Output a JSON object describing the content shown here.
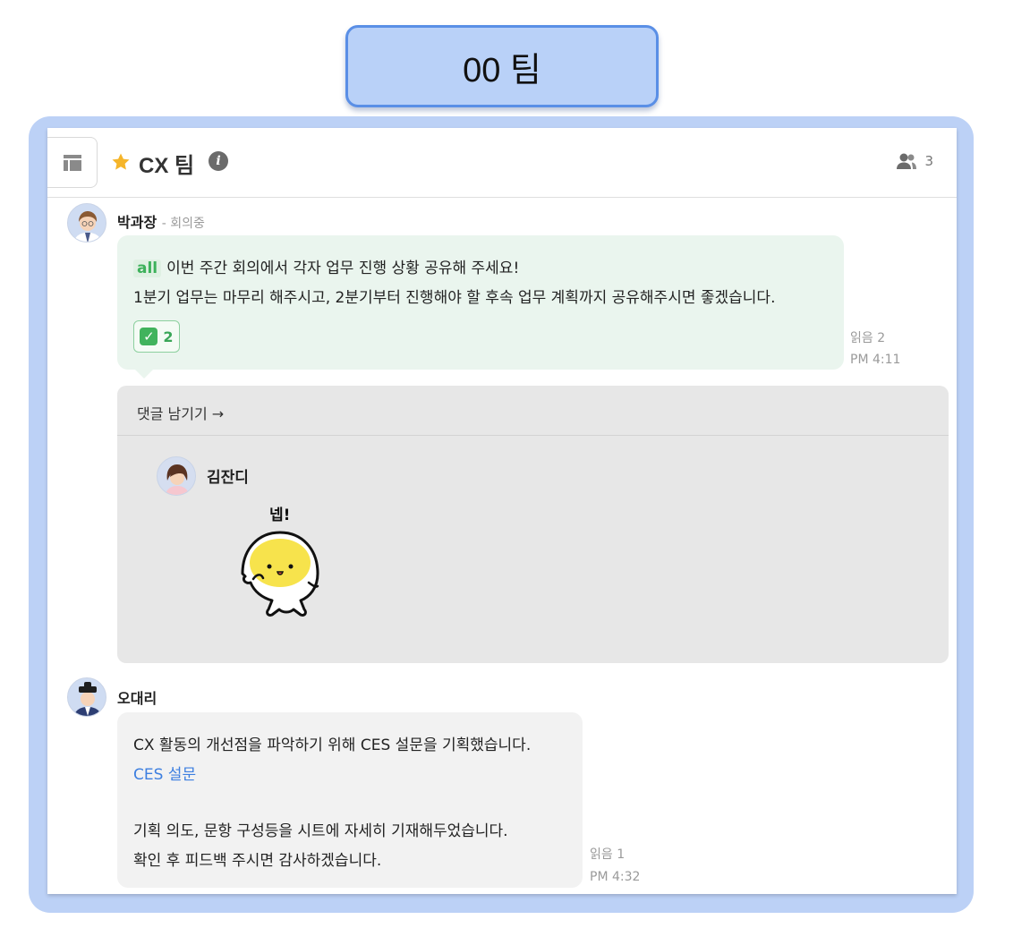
{
  "team_label": "00 팀",
  "header": {
    "title": "CX 팀",
    "member_count": "3"
  },
  "message1": {
    "author": "박과장",
    "status": "- 회의중",
    "mention": "all",
    "line1": "이번 주간 회의에서 각자 업무 진행 상황 공유해 주세요!",
    "line2": "1분기 업무는 마무리 해주시고, 2분기부터 진행해야 할 후속 업무 계획까지 공유해주시면 좋겠습니다.",
    "reaction_count": "2",
    "read": "읽음 2",
    "time": "PM 4:11"
  },
  "thread": {
    "comment_link": "댓글 남기기 →",
    "reply_author": "김잔디",
    "sticker_text": "넵!"
  },
  "message2": {
    "author": "오대리",
    "line1": "CX 활동의 개선점을 파악하기 위해 CES 설문을 기획했습니다.",
    "link_text": "CES 설문",
    "line3": "기획 의도, 문항 구성등을 시트에 자세히 기재해두었습니다.",
    "line4": "확인 후 피드백 주시면 감사하겠습니다.",
    "read": "읽음 1",
    "time": "PM 4:32"
  },
  "colors": {
    "frame": "#bcd1f6",
    "label_bg": "#b9d1f8",
    "label_border": "#5a8fe6",
    "mention_green": "#3db15b",
    "link_blue": "#3d7fe0",
    "star": "#f5b52a"
  },
  "icons": [
    "panel-icon",
    "star-icon",
    "info-icon",
    "members-icon",
    "check-icon"
  ]
}
